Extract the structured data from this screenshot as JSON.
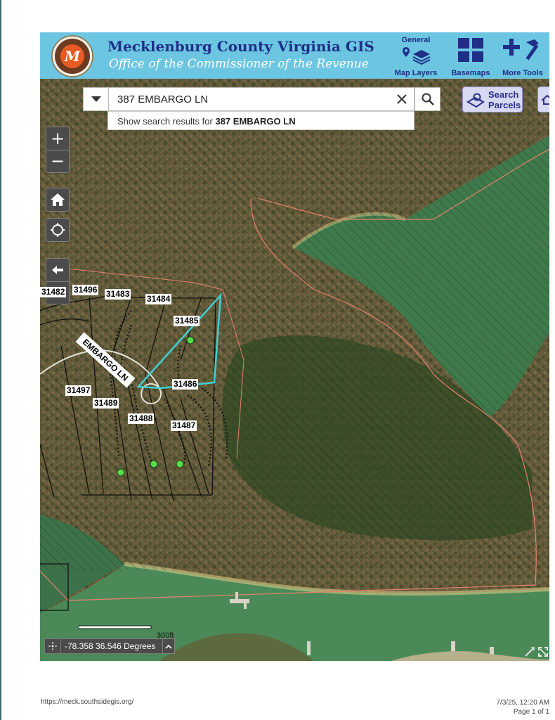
{
  "header": {
    "title": "Mecklenburg County Virginia GIS",
    "subtitle": "Office of the Commissioner of the Revenue",
    "logo_letter": "M",
    "logo_ring_text": "MECKLENBURG COUNTY VIRGINIA",
    "tools": [
      {
        "top_label": "General",
        "label": "Map Layers",
        "icon": "layers-icon"
      },
      {
        "label": "Basemaps",
        "icon": "grid-icon"
      },
      {
        "label": "More Tools",
        "icon": "tools-icon"
      }
    ]
  },
  "search": {
    "value": "387 EMBARGO LN",
    "suggestion_prefix": "Show search results for",
    "suggestion_term": "387 EMBARGO LN"
  },
  "search_parcels": {
    "line1": "Search",
    "line2": "Parcels"
  },
  "map": {
    "road_label": "EMBARGO LN",
    "parcels": [
      "31482",
      "31496",
      "31483",
      "31484",
      "31485",
      "31486",
      "31497",
      "31489",
      "31488",
      "31487"
    ],
    "scale_label": "300ft",
    "coordinates": "-78.358 36.546 Degrees"
  },
  "colors": {
    "header_bg": "#6cc6e2",
    "title": "#1f2f87",
    "selected_parcel": "#3fd0d4",
    "parcel_point": "#54e04a",
    "lake": "#3f7a4c"
  },
  "footer": {
    "url": "https://meck.southsidegis.org/",
    "datetime": "7/3/25, 12:20 AM",
    "page": "Page 1 of 1"
  }
}
